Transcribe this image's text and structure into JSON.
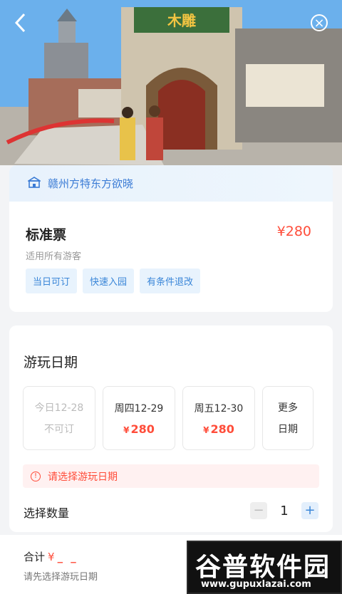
{
  "hero": {
    "sign_text": "木雕"
  },
  "venue": {
    "name": "赣州方特东方欲晓"
  },
  "ticket": {
    "title": "标准票",
    "price": "¥280",
    "subtitle": "适用所有游客",
    "tags": [
      "当日可订",
      "快速入园",
      "有条件退改"
    ]
  },
  "date_section": {
    "title": "游玩日期",
    "dates": [
      {
        "label": "今日12-28",
        "status": "不可订"
      },
      {
        "label": "周四12-29",
        "currency": "¥",
        "price": "280"
      },
      {
        "label": "周五12-30",
        "currency": "¥",
        "price": "280"
      }
    ],
    "more": {
      "line1": "更多",
      "line2": "日期"
    },
    "warning": "请选择游玩日期"
  },
  "quantity": {
    "label": "选择数量",
    "value": "1",
    "minus": "−",
    "plus": "+"
  },
  "footer": {
    "total_label": "合计",
    "currency": "¥",
    "total_value": "_ _",
    "note": "请先选择游玩日期"
  },
  "watermark": {
    "title": "谷普软件园",
    "url": "www.gupuxlazai.com"
  },
  "icons": [
    "back-icon",
    "close-icon",
    "venue-icon",
    "warning-icon"
  ],
  "colors": {
    "accent": "#3a86d8",
    "price": "#ff4d3a"
  }
}
